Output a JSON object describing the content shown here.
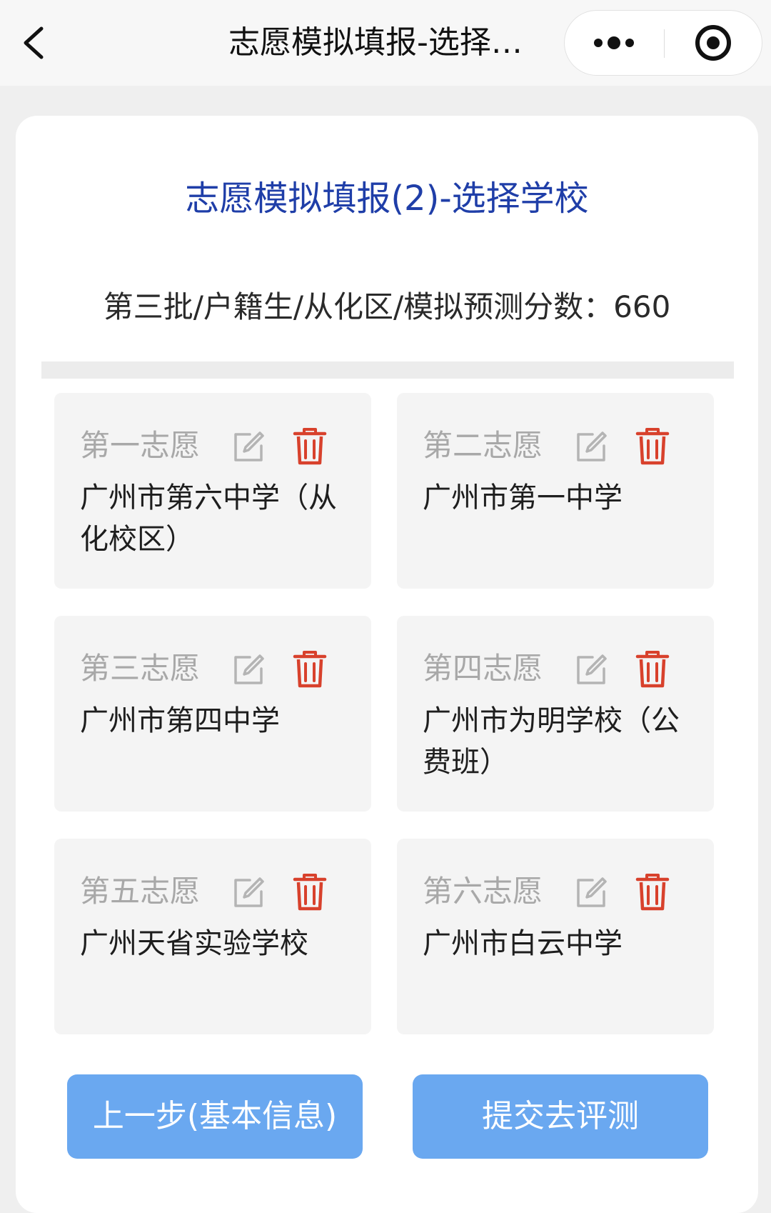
{
  "navbar": {
    "title": "志愿模拟填报-选择学校"
  },
  "page": {
    "title": "志愿模拟填报(2)-选择学校",
    "info_line": "第三批/户籍生/从化区/模拟预测分数：660"
  },
  "choices": [
    {
      "label": "第一志愿",
      "school": "广州市第六中学（从化校区）"
    },
    {
      "label": "第二志愿",
      "school": "广州市第一中学"
    },
    {
      "label": "第三志愿",
      "school": "广州市第四中学"
    },
    {
      "label": "第四志愿",
      "school": "广州市为明学校（公费班）"
    },
    {
      "label": "第五志愿",
      "school": "广州天省实验学校"
    },
    {
      "label": "第六志愿",
      "school": "广州市白云中学"
    }
  ],
  "actions": {
    "prev_label": "上一步(基本信息)",
    "submit_label": "提交去评测"
  },
  "colors": {
    "title_blue": "#1f3ea8",
    "button_blue": "#6aa8f0",
    "delete_red": "#d8412c",
    "label_gray": "#a8a8a8"
  },
  "icons": {
    "back": "chevron-left-icon",
    "more": "more-dots-icon",
    "close": "target-close-icon",
    "edit": "edit-icon",
    "delete": "trash-icon"
  }
}
